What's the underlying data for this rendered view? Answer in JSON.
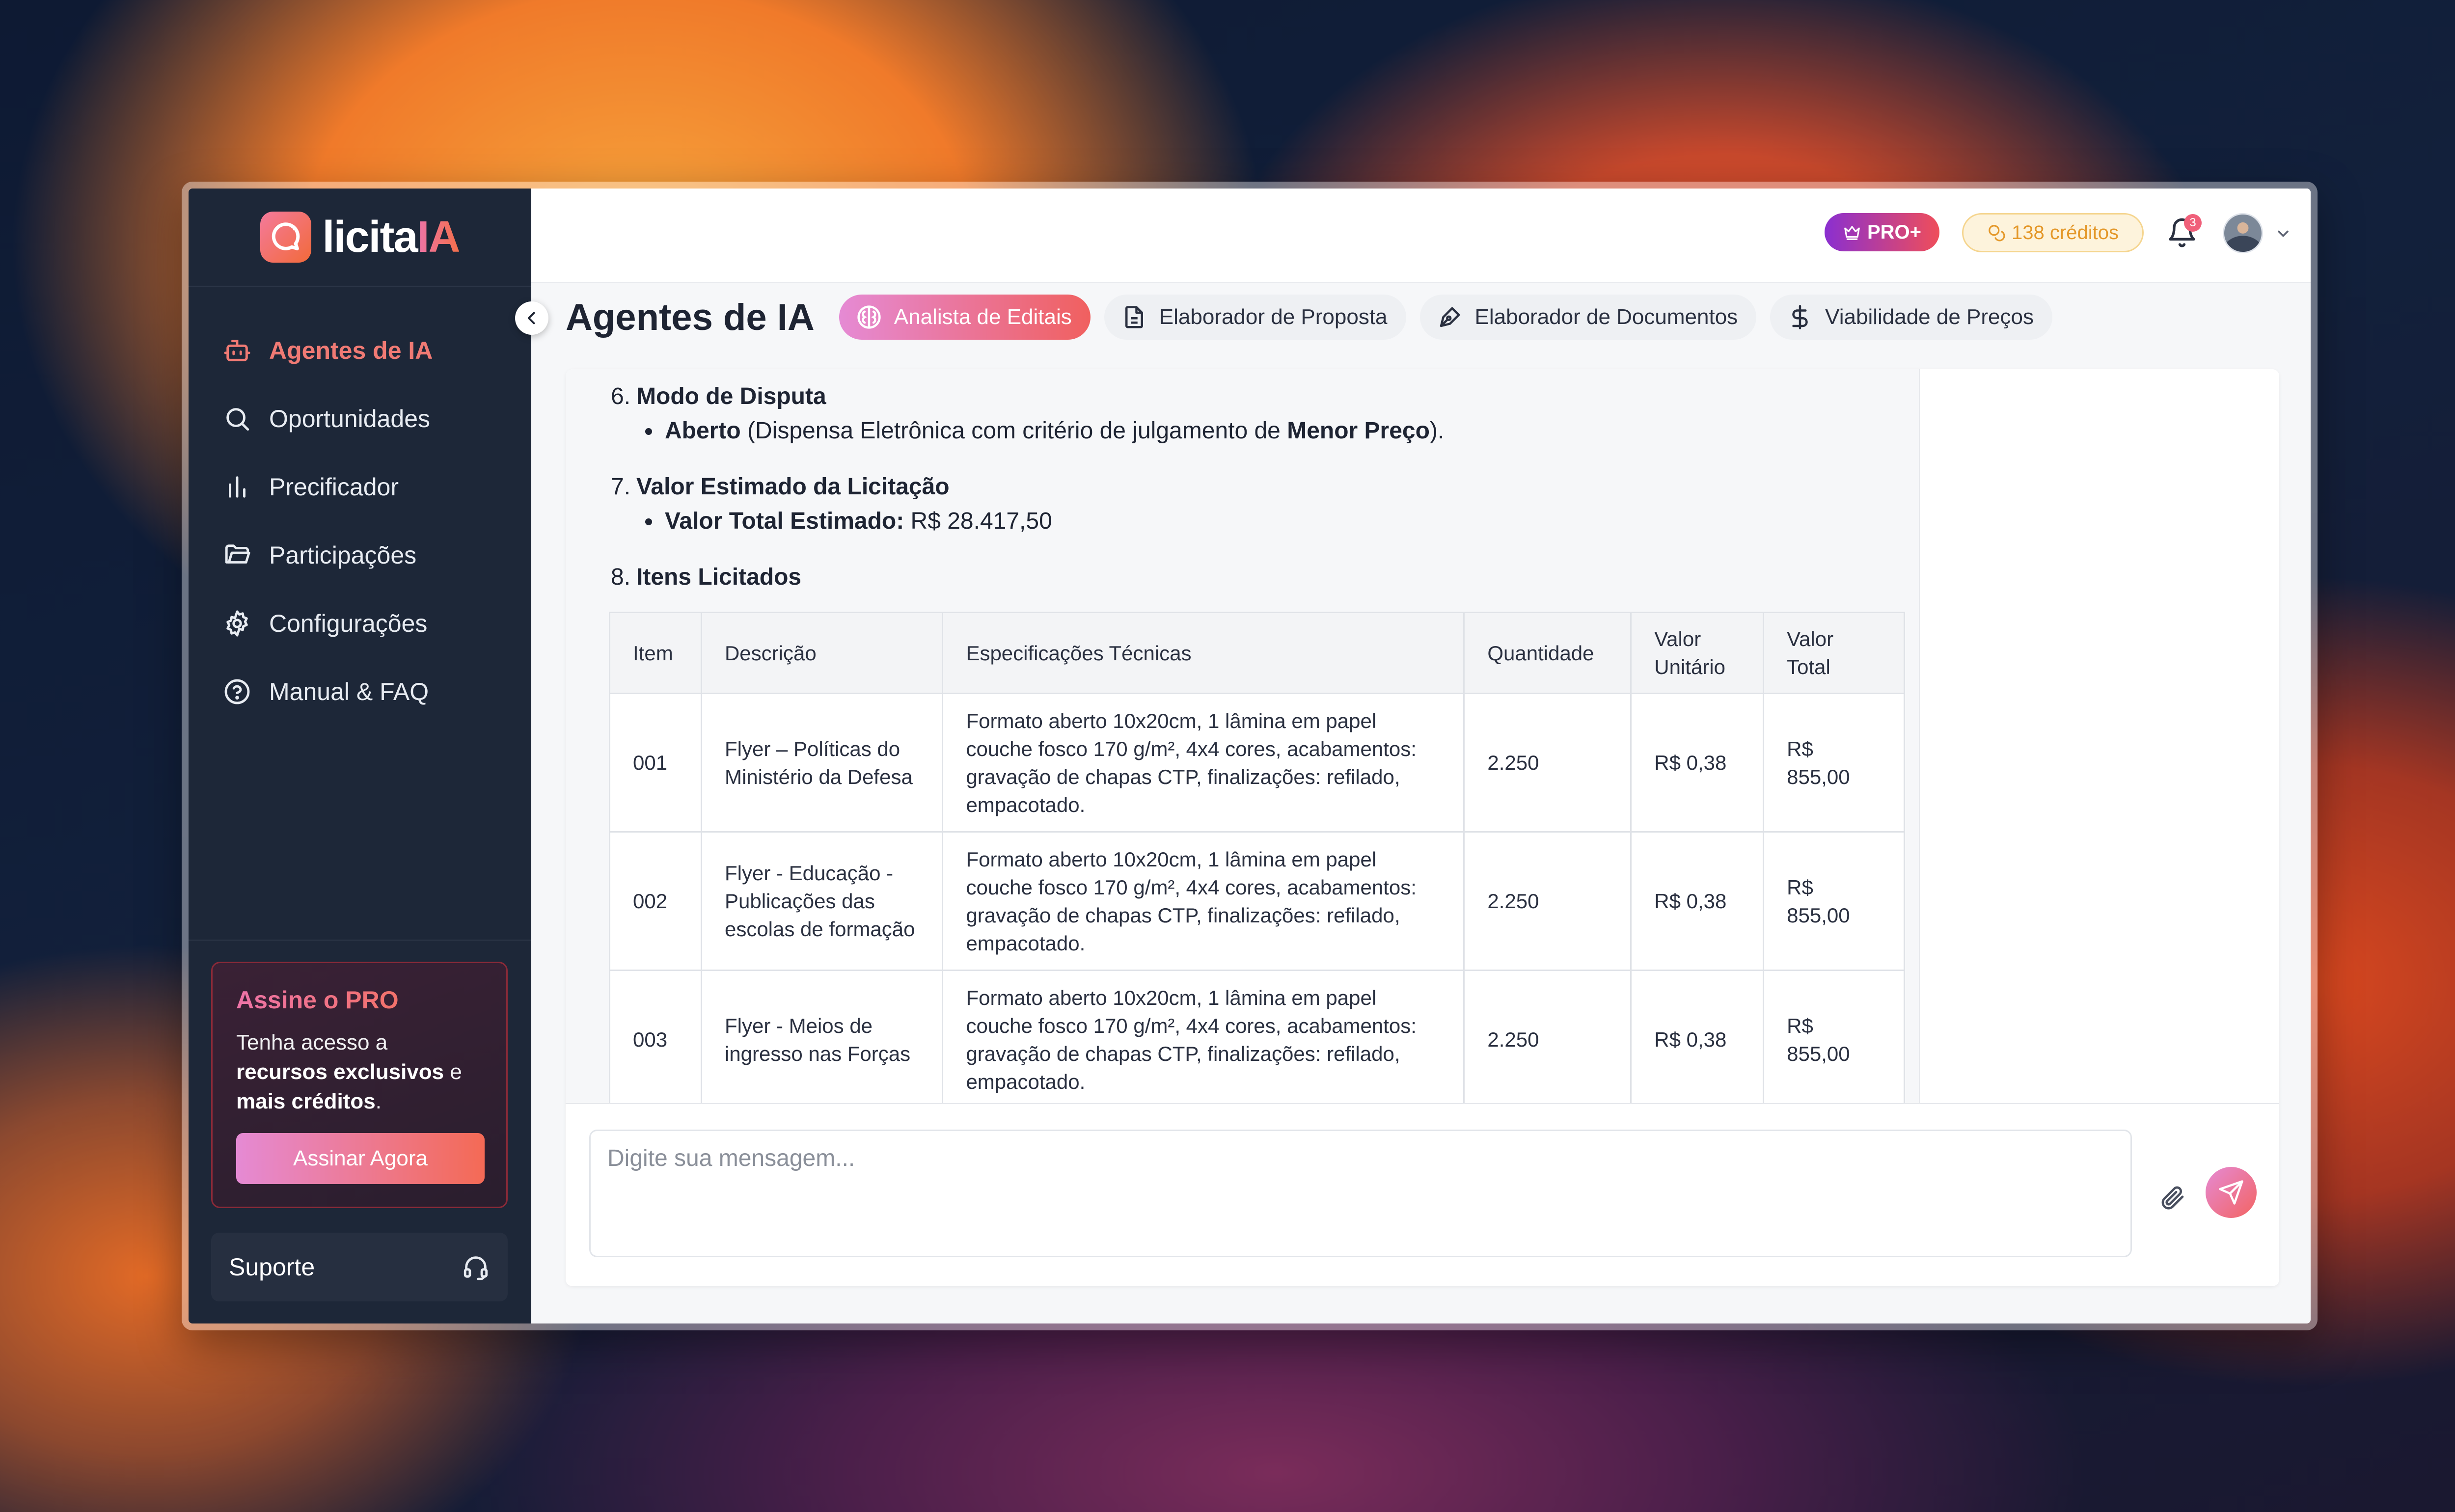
{
  "brand": {
    "name_part1": "licita",
    "name_part2": "IA"
  },
  "sidebar": {
    "items": [
      {
        "label": "Agentes de IA",
        "icon": "robot-icon",
        "active": true
      },
      {
        "label": "Oportunidades",
        "icon": "search-icon"
      },
      {
        "label": "Precificador",
        "icon": "bar-chart-icon"
      },
      {
        "label": "Participações",
        "icon": "folder-icon"
      },
      {
        "label": "Configurações",
        "icon": "gear-icon"
      },
      {
        "label": "Manual & FAQ",
        "icon": "help-circle-icon"
      }
    ],
    "promo": {
      "title": "Assine o PRO",
      "text_1": "Tenha acesso a ",
      "text_bold_1": "recursos exclusivos",
      "text_2": " e ",
      "text_bold_2": "mais créditos",
      "text_3": ".",
      "button_label": "Assinar Agora"
    },
    "support_label": "Suporte"
  },
  "header": {
    "pro_badge": "PRO+",
    "credits": "138 créditos",
    "notifications_count": "3"
  },
  "page": {
    "title": "Agentes de IA",
    "tabs": [
      {
        "label": "Analista de Editais",
        "icon": "brain-icon",
        "active": true
      },
      {
        "label": "Elaborador de Proposta",
        "icon": "document-icon"
      },
      {
        "label": "Elaborador de Documentos",
        "icon": "pen-tool-icon"
      },
      {
        "label": "Viabilidade de Preços",
        "icon": "dollar-icon"
      }
    ]
  },
  "message": {
    "s6_num": "6.",
    "s6_title": "Modo de Disputa",
    "s6_bullet_bold": "Aberto",
    "s6_bullet_text_1": " (Dispensa Eletrônica com critério de julgamento de ",
    "s6_bullet_bold_2": "Menor Preço",
    "s6_bullet_text_2": ").",
    "s7_num": "7.",
    "s7_title": "Valor Estimado da Licitação",
    "s7_bullet_bold": "Valor Total Estimado:",
    "s7_bullet_text": " R$ 28.417,50",
    "s8_num": "8.",
    "s8_title": "Itens Licitados"
  },
  "table": {
    "headers": {
      "item": "Item",
      "descricao": "Descrição",
      "especificacoes": "Especificações Técnicas",
      "quantidade": "Quantidade",
      "valor_unitario": "Valor Unitário",
      "valor_total": "Valor Total"
    },
    "rows": [
      {
        "item": "001",
        "descricao": "Flyer – Políticas do Ministério da Defesa",
        "especificacoes": "Formato aberto 10x20cm, 1 lâmina em papel couche fosco 170 g/m², 4x4 cores, acabamentos: gravação de chapas CTP, finalizações: refilado, empacotado.",
        "quantidade": "2.250",
        "valor_unitario": "R$ 0,38",
        "valor_total": "R$ 855,00"
      },
      {
        "item": "002",
        "descricao": "Flyer - Educação - Publicações das escolas de formação",
        "especificacoes": "Formato aberto 10x20cm, 1 lâmina em papel couche fosco 170 g/m², 4x4 cores, acabamentos: gravação de chapas CTP, finalizações: refilado, empacotado.",
        "quantidade": "2.250",
        "valor_unitario": "R$ 0,38",
        "valor_total": "R$ 855,00"
      },
      {
        "item": "003",
        "descricao": "Flyer - Meios de ingresso nas Forças",
        "especificacoes": "Formato aberto 10x20cm, 1 lâmina em papel couche fosco 170 g/m², 4x4 cores, acabamentos: gravação de chapas CTP, finalizações: refilado, empacotado.",
        "quantidade": "2.250",
        "valor_unitario": "R$ 0,38",
        "valor_total": "R$ 855,00"
      }
    ]
  },
  "composer": {
    "placeholder": "Digite sua mensagem..."
  },
  "colors": {
    "accent_pink": "#e58ad4",
    "accent_coral": "#f0605f",
    "sidebar_bg": "#1d2738",
    "credits_amber": "#e4982a"
  }
}
